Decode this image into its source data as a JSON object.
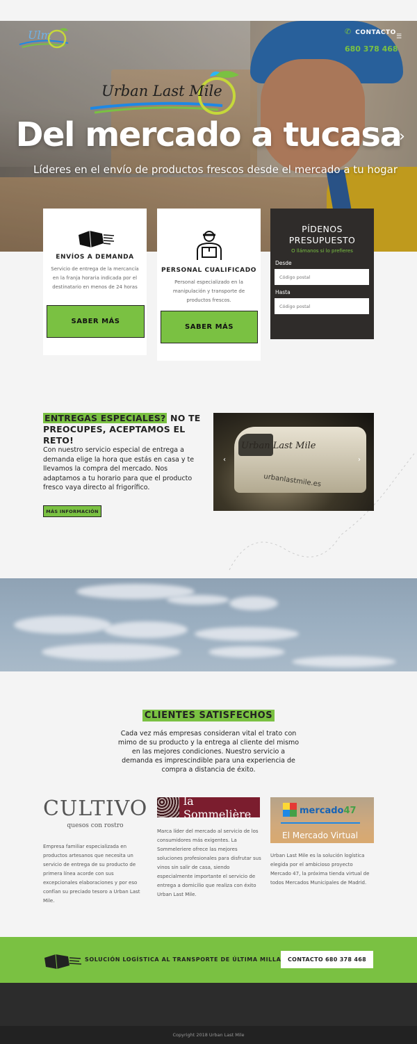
{
  "header": {
    "contact_label": "CONTACTO",
    "phone": "680 378 468"
  },
  "hero": {
    "logo_text": "Urban Last Mile",
    "title": "Del mercado a tucasa",
    "subtitle": "Líderes en el envío de productos frescos desde el mercado a tu hogar"
  },
  "cards": [
    {
      "title": "ENVÍOS A DEMANDA",
      "text": "Servicio de entrega de la mercancía en la franja horaria indicada por el destinatario en menos de 24 horas",
      "button": "SABER MÁS"
    },
    {
      "title": "PERSONAL CUALIFICADO",
      "text": "Personal especializado en la manipulación y transporte de productos frescos.",
      "button": "SABER MÁS"
    }
  ],
  "quote": {
    "title_line1": "PÍDENOS",
    "title_line2": "PRESUPUESTO",
    "hint": "O llámanos si lo prefieres",
    "from_label": "Desde",
    "from_placeholder": "Código postal",
    "to_label": "Hasta",
    "to_placeholder": "Código postal"
  },
  "special": {
    "title_highlight": "ENTREGAS ESPECIALES?",
    "title_rest": " NO TE PREOCUPES, ACEPTAMOS EL RETO!",
    "text": "Con nuestro servicio especial  de entrega a demanda elige la hora que estás en casa y te llevamos la compra del mercado. Nos adaptamos a tu horario para que el producto fresco vaya directo al frigorífico.",
    "button": "MÁS INFORMACIÓN",
    "slide_logo": "Urban Last Mile",
    "slide_url": "urbanlastmile.es"
  },
  "clients": {
    "title": "CLIENTES  SATISFECHOS",
    "intro": "Cada vez más empresas consideran vital el trato con mimo de su producto y  la entrega al cliente del mismo en las mejores condiciones.  Nuestro servicio a demanda  es imprescindible para una  experiencia de compra a distancia de éxito.",
    "items": [
      {
        "logo_main": "CULTIVO",
        "logo_sub": "quesos con rostro",
        "text": "Empresa familiar especializada en productos artesanos que necesita un servicio de entrega de su producto de primera línea acorde con sus excepcionales elaboraciones y por eso confían su preciado tesoro a Urban Last Mile."
      },
      {
        "logo_main": "la Sommelière",
        "text": "Marca líder del mercado al servicio de los consumidores más exigentes.  La Sommeleriere ofrece las mejores soluciones profesionales para disfrutar sus vinos sin salir de casa, siendo especialmente importante el servicio de entrega a domicilio que realiza con éxito Urban Last Mile."
      },
      {
        "logo_main_a": "mercado",
        "logo_main_b": "47",
        "logo_sub": "El Mercado Virtual",
        "text": "Urban Last Mile es la solución logística elegida por el ambicioso proyecto Mercado 47, la próxima tienda virtual de todos Mercados Municipales de Madrid."
      }
    ]
  },
  "cta": {
    "text": "SOLUCIÓN LOGÍSTICA AL TRANSPORTE DE ÚLTIMA MILLA.",
    "button": "CONTACTO 680 378 468"
  },
  "footer": {
    "copyright": "Copyright 2018 Urban Last Mile"
  },
  "colors": {
    "accent": "#7ac142",
    "dark": "#2f2c2a"
  }
}
